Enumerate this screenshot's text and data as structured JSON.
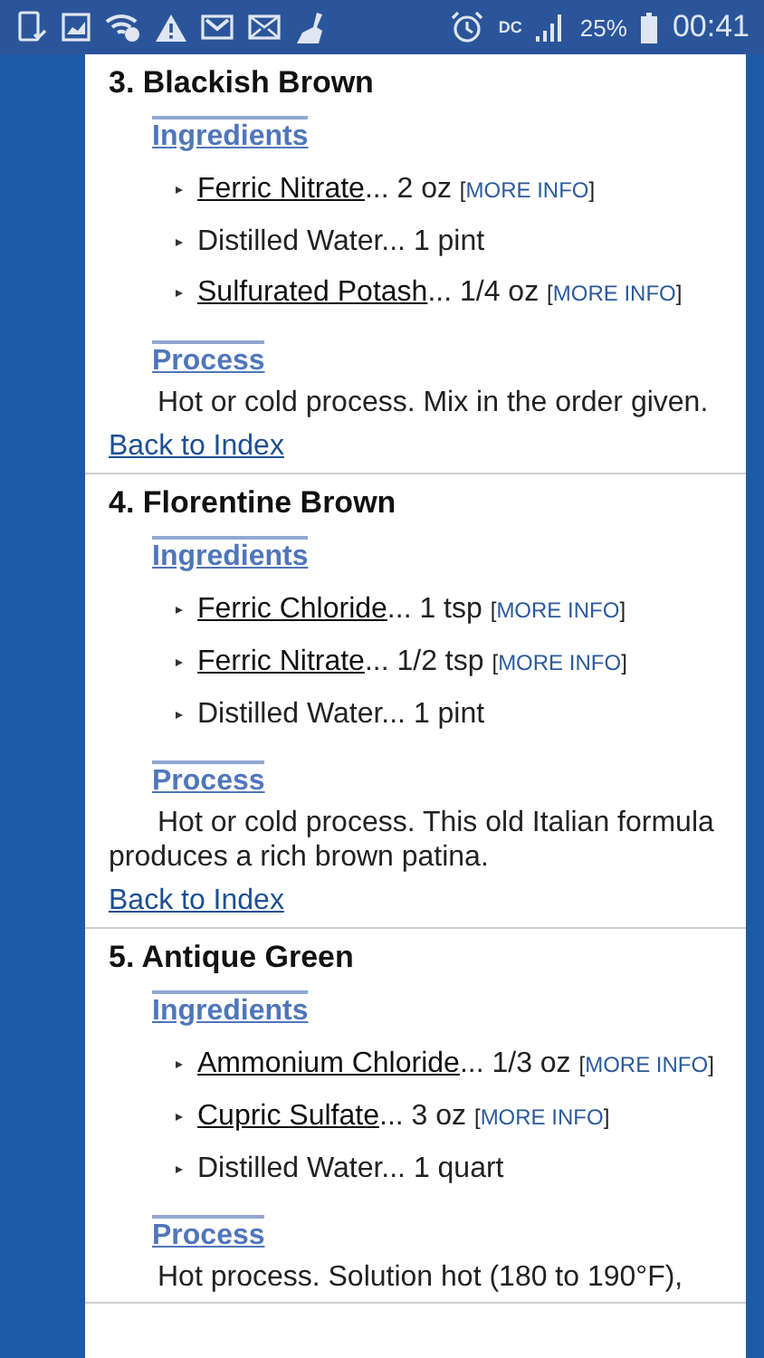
{
  "status_bar": {
    "data_label": "DC",
    "battery": "25%",
    "time": "00:41"
  },
  "sections": [
    {
      "title": "3. Blackish Brown",
      "ingredients_heading": "Ingredients",
      "ingredients": [
        {
          "parts": [
            {
              "kind": "link",
              "text": "Ferric Nitrate"
            },
            {
              "kind": "text",
              "text": "... 2 oz "
            },
            {
              "kind": "small",
              "text": "["
            },
            {
              "kind": "more",
              "text": "MORE INFO"
            },
            {
              "kind": "small",
              "text": "]"
            }
          ]
        },
        {
          "parts": [
            {
              "kind": "text",
              "text": "Distilled Water... 1 pint"
            }
          ]
        },
        {
          "parts": [
            {
              "kind": "link",
              "text": "Sulfurated Potash"
            },
            {
              "kind": "text",
              "text": "... 1/4 oz "
            },
            {
              "kind": "small",
              "text": "["
            },
            {
              "kind": "more",
              "text": "MORE INFO"
            },
            {
              "kind": "small",
              "text": "]"
            }
          ]
        }
      ],
      "process_heading": "Process",
      "process": "Hot or cold process. Mix in the order given.",
      "back_link": "Back to Index"
    },
    {
      "title": "4. Florentine Brown",
      "ingredients_heading": "Ingredients",
      "ingredients": [
        {
          "parts": [
            {
              "kind": "link",
              "text": "Ferric Chloride"
            },
            {
              "kind": "text",
              "text": "... 1 tsp "
            },
            {
              "kind": "small",
              "text": "["
            },
            {
              "kind": "more",
              "text": "MORE INFO"
            },
            {
              "kind": "small",
              "text": "]"
            }
          ]
        },
        {
          "parts": [
            {
              "kind": "link",
              "text": "Ferric Nitrate"
            },
            {
              "kind": "text",
              "text": "... 1/2 tsp "
            },
            {
              "kind": "small",
              "text": "["
            },
            {
              "kind": "more",
              "text": "MORE INFO"
            },
            {
              "kind": "small",
              "text": "]"
            }
          ]
        },
        {
          "parts": [
            {
              "kind": "text",
              "text": "Distilled Water... 1 pint"
            }
          ]
        }
      ],
      "process_heading": "Process",
      "process": "Hot or cold process. This old Italian formula produces a rich brown patina.",
      "back_link": "Back to Index"
    },
    {
      "title": "5. Antique Green",
      "ingredients_heading": "Ingredients",
      "ingredients": [
        {
          "parts": [
            {
              "kind": "link",
              "text": "Ammonium Chloride"
            },
            {
              "kind": "text",
              "text": "... 1/3 oz "
            },
            {
              "kind": "small",
              "text": "["
            },
            {
              "kind": "more",
              "text": "MORE INFO"
            },
            {
              "kind": "small",
              "text": "]"
            }
          ]
        },
        {
          "parts": [
            {
              "kind": "link",
              "text": "Cupric Sulfate"
            },
            {
              "kind": "text",
              "text": "... 3 oz "
            },
            {
              "kind": "small",
              "text": "["
            },
            {
              "kind": "more",
              "text": "MORE INFO"
            },
            {
              "kind": "small",
              "text": "]"
            }
          ]
        },
        {
          "parts": [
            {
              "kind": "text",
              "text": "Distilled Water... 1 quart"
            }
          ]
        }
      ],
      "process_heading": "Process",
      "process": "Hot process. Solution hot (180 to 190°F),"
    }
  ]
}
